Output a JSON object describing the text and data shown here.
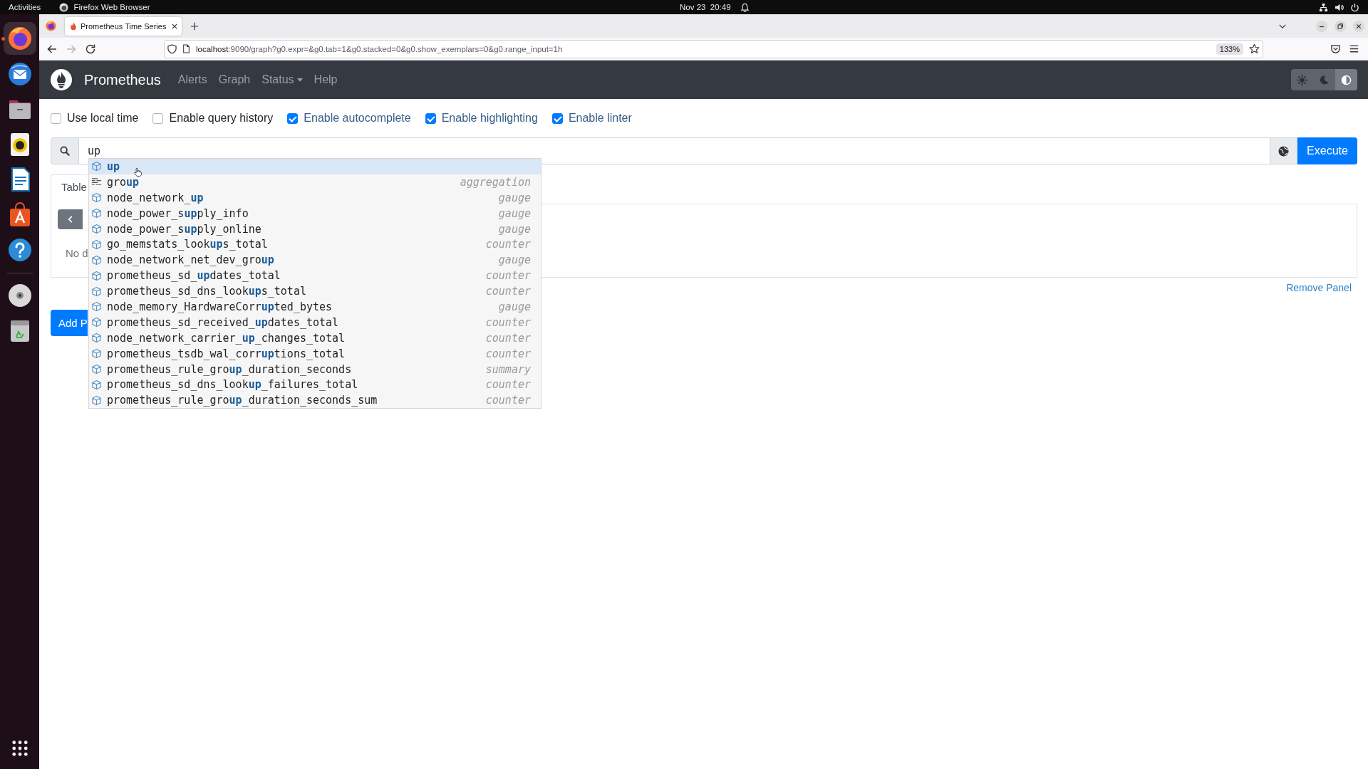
{
  "top_bar": {
    "activities": "Activities",
    "app_menu": "Firefox Web Browser",
    "clock": "Nov 23  20:49"
  },
  "dock": {
    "apps": [
      {
        "kind": "browser",
        "running": true
      },
      {
        "kind": "mail",
        "running": false
      },
      {
        "kind": "files",
        "running": false
      },
      {
        "kind": "music",
        "running": false
      },
      {
        "kind": "writer",
        "running": false
      },
      {
        "kind": "store",
        "running": false
      },
      {
        "kind": "help",
        "running": false
      }
    ],
    "devices": [
      {
        "kind": "disc"
      },
      {
        "kind": "trash"
      }
    ]
  },
  "browser": {
    "tabs": [
      {
        "title": "Prometheus Time Series",
        "selected": true
      }
    ],
    "back": {
      "disabled": false
    },
    "forward": {
      "disabled": true
    },
    "url": {
      "host": "localhost",
      "rest": ":9090/graph?g0.expr=&g0.tab=1&g0.stacked=0&g0.show_exemplars=0&g0.range_input=1h"
    },
    "zoom": "133%"
  },
  "navbar": {
    "brand": "Prometheus",
    "links": [
      {
        "label": "Alerts",
        "dropdown": false
      },
      {
        "label": "Graph",
        "dropdown": false
      },
      {
        "label": "Status",
        "dropdown": true
      },
      {
        "label": "Help",
        "dropdown": false
      }
    ],
    "theme_buttons": [
      {
        "kind": "light",
        "selected": false
      },
      {
        "kind": "dark",
        "selected": false
      },
      {
        "kind": "auto",
        "selected": true
      }
    ]
  },
  "options": [
    {
      "label": "Use local time",
      "checked": false
    },
    {
      "label": "Enable query history",
      "checked": false
    },
    {
      "label": "Enable autocomplete",
      "checked": true
    },
    {
      "label": "Enable highlighting",
      "checked": true
    },
    {
      "label": "Enable linter",
      "checked": true
    }
  ],
  "expression": {
    "value": "up",
    "autocomplete": [
      {
        "label": "up",
        "exact_match": true,
        "kind": "metric",
        "selected": true
      },
      {
        "label": "gro**up**",
        "exact_match": false,
        "kind": "aggregation",
        "type": "aggregation",
        "selected": false
      },
      {
        "label": "node_network_**up**",
        "exact_match": false,
        "kind": "metric",
        "type": "gauge",
        "selected": false
      },
      {
        "label": "node_power_s**up**ply_info",
        "exact_match": false,
        "kind": "metric",
        "type": "gauge",
        "selected": false
      },
      {
        "label": "node_power_s**up**ply_online",
        "exact_match": false,
        "kind": "metric",
        "type": "gauge",
        "selected": false
      },
      {
        "label": "go_memstats_look**up**s_total",
        "exact_match": false,
        "kind": "metric",
        "type": "counter",
        "selected": false
      },
      {
        "label": "node_network_net_dev_gro**up**",
        "exact_match": false,
        "kind": "metric",
        "type": "gauge",
        "selected": false
      },
      {
        "label": "prometheus_sd_**up**dates_total",
        "exact_match": false,
        "kind": "metric",
        "type": "counter",
        "selected": false
      },
      {
        "label": "prometheus_sd_dns_look**up**s_total",
        "exact_match": false,
        "kind": "metric",
        "type": "counter",
        "selected": false
      },
      {
        "label": "node_memory_HardwareCorr**up**ted_bytes",
        "exact_match": false,
        "kind": "metric",
        "type": "gauge",
        "selected": false
      },
      {
        "label": "prometheus_sd_received_**up**dates_total",
        "exact_match": false,
        "kind": "metric",
        "type": "counter",
        "selected": false
      },
      {
        "label": "node_network_carrier_**up**_changes_total",
        "exact_match": false,
        "kind": "metric",
        "type": "counter",
        "selected": false
      },
      {
        "label": "prometheus_tsdb_wal_corr**up**tions_total",
        "exact_match": false,
        "kind": "metric",
        "type": "counter",
        "selected": false
      },
      {
        "label": "prometheus_rule_gro**up**_duration_seconds",
        "exact_match": false,
        "kind": "metric",
        "type": "summary",
        "selected": false
      },
      {
        "label": "prometheus_sd_dns_look**up**_failures_total",
        "exact_match": false,
        "kind": "metric",
        "type": "counter",
        "selected": false
      },
      {
        "label": "prometheus_rule_gro**up**_duration_seconds_sum",
        "exact_match": false,
        "kind": "metric",
        "type": "counter",
        "selected": false
      }
    ]
  },
  "execute_button": "Execute",
  "panel": {
    "tabs": [
      {
        "label": "Table",
        "selected": true
      }
    ],
    "empty_message": "No d",
    "remove_link": "Remove Panel"
  },
  "add_panel_button": "Add P"
}
